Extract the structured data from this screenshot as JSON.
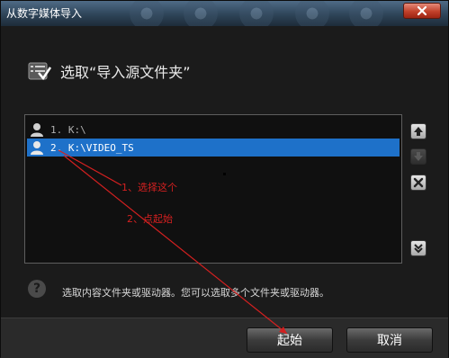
{
  "window": {
    "title": "从数字媒体导入",
    "close_icon": "close-icon"
  },
  "header": {
    "icon": "folder-checklist-icon",
    "text": "选取“导入源文件夹”"
  },
  "folder_list": {
    "items": [
      {
        "path": "1. K:\\",
        "selected": false,
        "icon": "user-icon"
      },
      {
        "path": "2. K:\\VIDEO_TS",
        "selected": true,
        "icon": "user-icon"
      }
    ]
  },
  "side_buttons": [
    {
      "name": "move-up",
      "icon": "arrow-up-icon",
      "enabled": true
    },
    {
      "name": "move-down",
      "icon": "arrow-down-icon",
      "enabled": false
    },
    {
      "name": "remove",
      "icon": "close-icon",
      "enabled": true
    },
    {
      "name": "expand",
      "icon": "double-chevron-down-icon",
      "enabled": true
    }
  ],
  "hint": {
    "icon": "help-icon",
    "text": "选取内容文件夹或驱动器。您可以选取多个文件夹或驱动器。"
  },
  "footer": {
    "start_label": "起始",
    "cancel_label": "取消"
  },
  "annotations": {
    "step1": "1、选择这个",
    "step2": "2、点起始",
    "color": "#d42020"
  }
}
